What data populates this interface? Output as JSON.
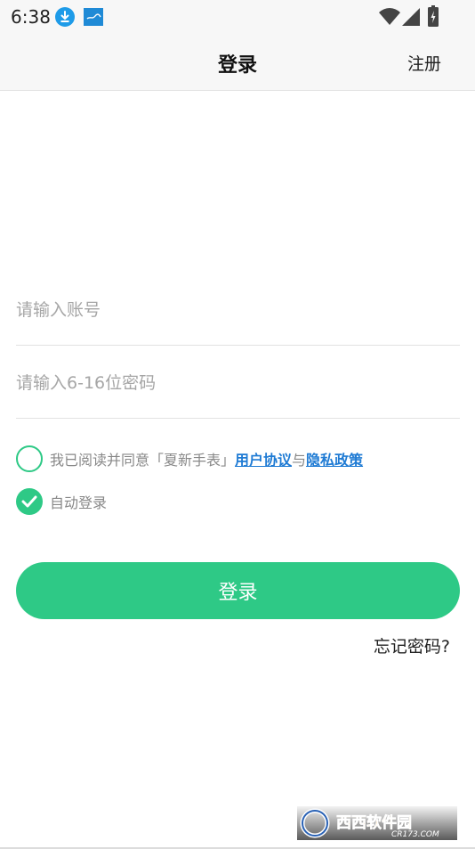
{
  "status_bar": {
    "time": "6:38"
  },
  "header": {
    "title": "登录",
    "register": "注册"
  },
  "form": {
    "account_placeholder": "请输入账号",
    "password_placeholder": "请输入6-16位密码",
    "agreement_prefix": "我已阅读并同意「夏新手表」",
    "user_agreement": "用户协议",
    "joiner": "与",
    "privacy_policy": "隐私政策",
    "auto_login": "自动登录",
    "agreement_checked": false,
    "auto_login_checked": true,
    "login_button": "登录",
    "forgot_password": "忘记密码?"
  },
  "watermark": {
    "brand": "西西软件园",
    "domain": "CR173.COM"
  },
  "colors": {
    "accent": "#2ec986",
    "link": "#1f7bd4",
    "placeholder": "#a6a6a6"
  },
  "icons": [
    "download-icon",
    "app-notification-icon",
    "wifi-icon",
    "signal-icon",
    "battery-icon",
    "checkmark-icon"
  ]
}
